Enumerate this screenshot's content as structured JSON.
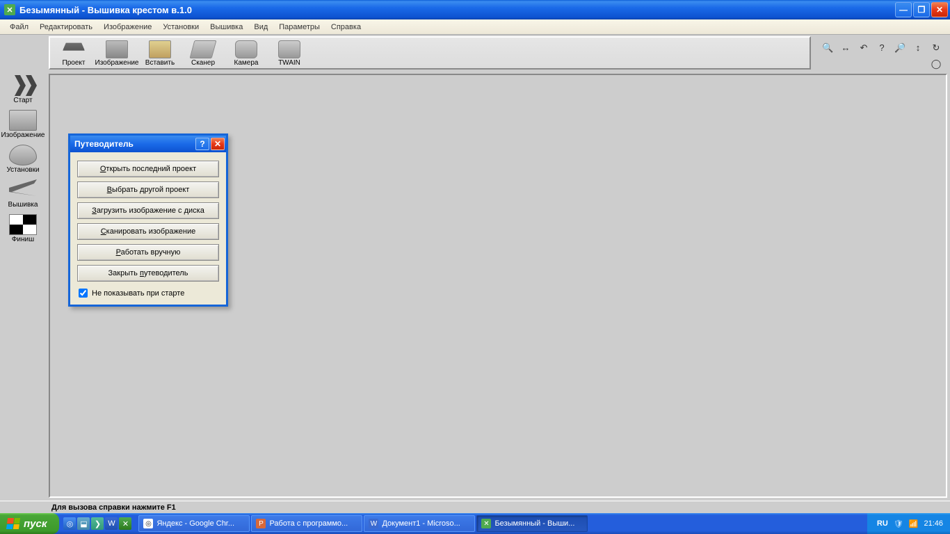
{
  "title": "Безымянный - Вышивка крестом в.1.0",
  "menu": [
    "Файл",
    "Редактировать",
    "Изображение",
    "Установки",
    "Вышивка",
    "Вид",
    "Параметры",
    "Справка"
  ],
  "toolbar": [
    {
      "id": "project",
      "label": "Проект"
    },
    {
      "id": "image",
      "label": "Изображение"
    },
    {
      "id": "paste",
      "label": "Вставить"
    },
    {
      "id": "scanner",
      "label": "Сканер"
    },
    {
      "id": "camera",
      "label": "Камера"
    },
    {
      "id": "twain",
      "label": "TWAIN"
    }
  ],
  "sidebar": [
    {
      "id": "start",
      "label": "Старт"
    },
    {
      "id": "image",
      "label": "Изображение"
    },
    {
      "id": "setup",
      "label": "Установки"
    },
    {
      "id": "embroidery",
      "label": "Вышивка"
    },
    {
      "id": "finish",
      "label": "Финиш"
    }
  ],
  "wizard": {
    "title": "Путеводитель",
    "buttons": [
      "Открыть последний проект",
      "Выбрать другой проект",
      "Загрузить изображение с диска",
      "Сканировать изображение",
      "Работать вручную",
      "Закрыть путеводитель"
    ],
    "checkbox_label": "Не показывать при старте",
    "checkbox_checked": true
  },
  "statusbar": "Для вызова справки нажмите F1",
  "taskbar": {
    "start": "пуск",
    "tasks": [
      {
        "label": "Яндекс - Google Chr...",
        "icon": "◎",
        "active": false
      },
      {
        "label": "Работа с программо...",
        "icon": "P",
        "active": false
      },
      {
        "label": "Документ1 - Microso...",
        "icon": "W",
        "active": false
      },
      {
        "label": "Безымянный - Выши...",
        "icon": "✕",
        "active": true
      }
    ],
    "lang": "RU",
    "clock": "21:46"
  }
}
